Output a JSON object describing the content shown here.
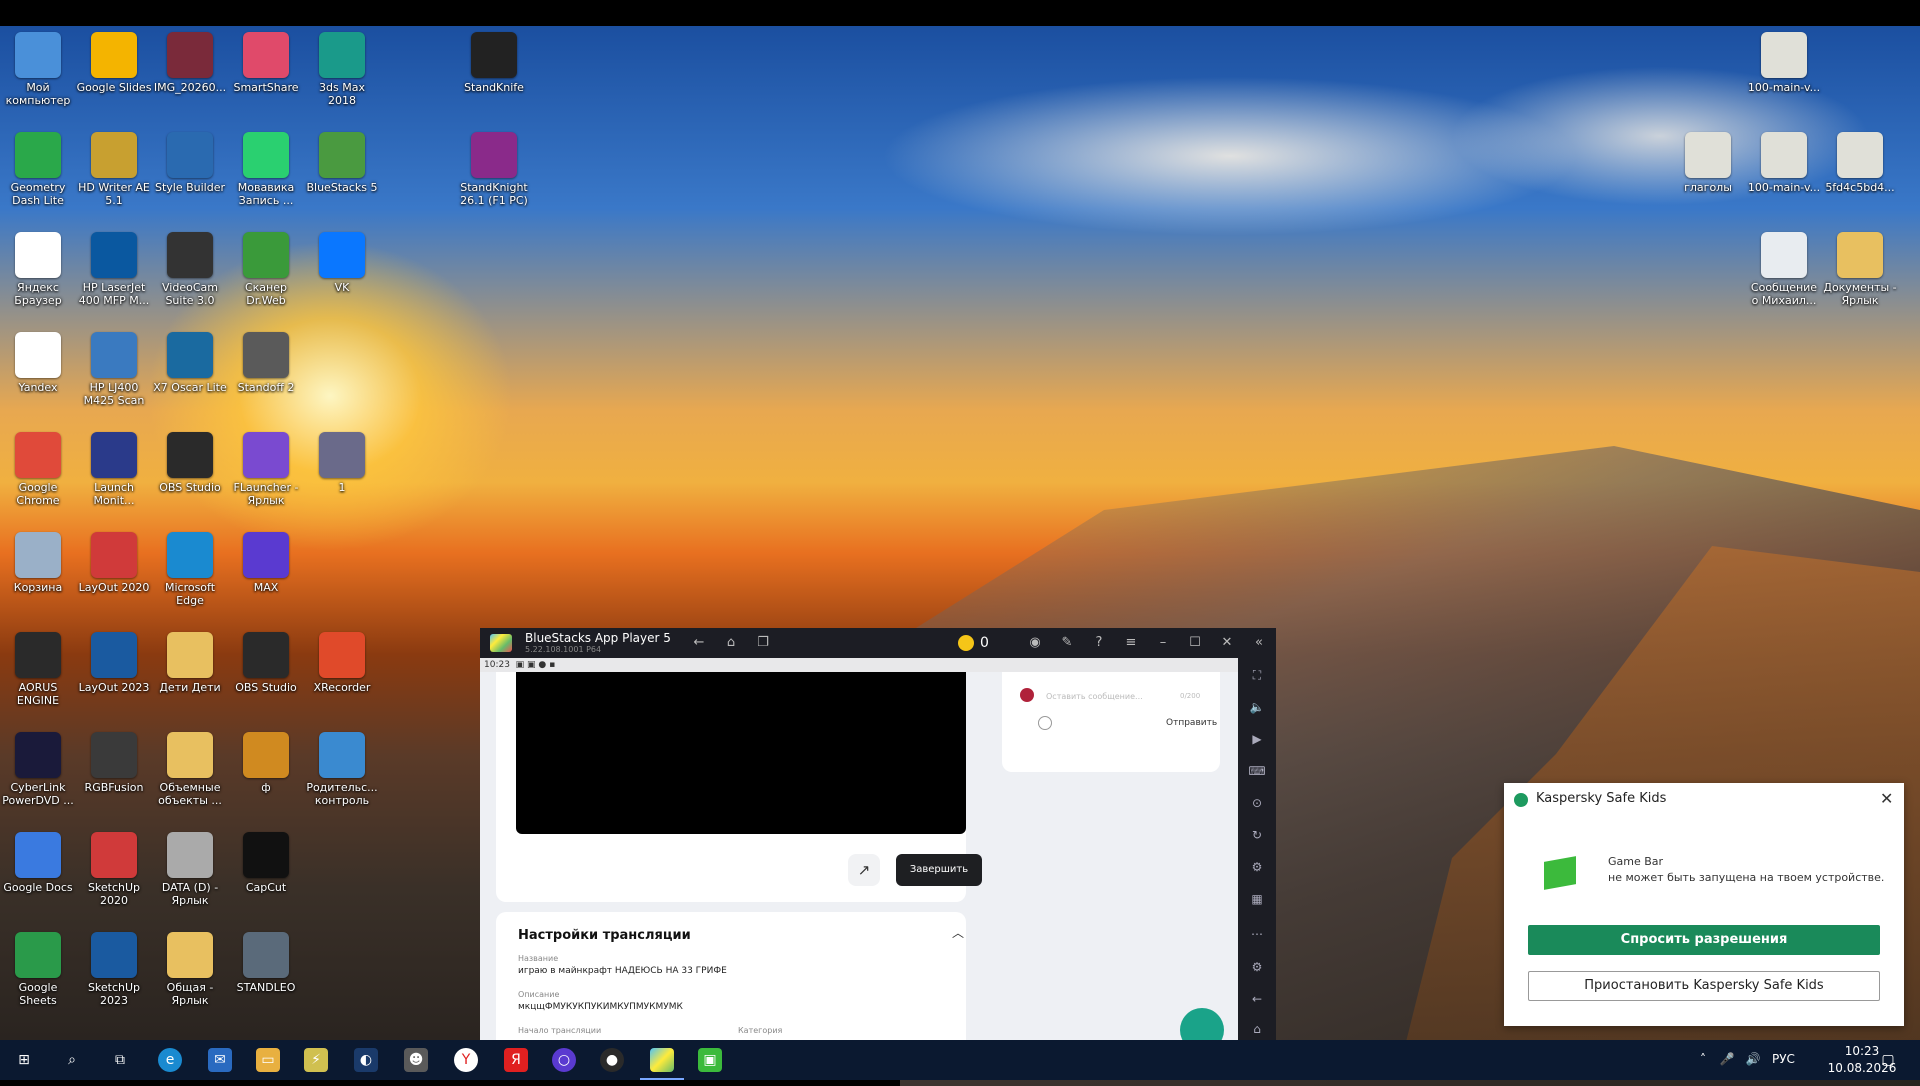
{
  "desktop": {
    "icons": [
      {
        "label": "Мой компьютер",
        "icon": "computer-icon",
        "color": "#4a90d9"
      },
      {
        "label": "Google Slides",
        "icon": "slides-icon",
        "color": "#f4b400"
      },
      {
        "label": "IMG_20260...",
        "icon": "image-icon",
        "color": "#7a2a3a"
      },
      {
        "label": "SmartShare",
        "icon": "smartshare-icon",
        "color": "#e04a6a"
      },
      {
        "label": "3ds Max 2018",
        "icon": "3dsmax-icon",
        "color": "#1a9a8a"
      },
      {
        "label": "StandKnife",
        "icon": "knife-icon",
        "color": "#222222"
      },
      {
        "label": "Geometry Dash Lite",
        "icon": "geometry-dash-icon",
        "color": "#2aa84a"
      },
      {
        "label": "HD Writer AE 5.1",
        "icon": "hd-writer-icon",
        "color": "#c8a030"
      },
      {
        "label": "Style Builder",
        "icon": "style-builder-icon",
        "color": "#2a6ab0"
      },
      {
        "label": "Мовавика Запись ...",
        "icon": "movavi-icon",
        "color": "#2ad070"
      },
      {
        "label": "BlueStacks 5",
        "icon": "bluestacks-icon",
        "color": "#4a9a40"
      },
      {
        "label": "StandKnight 26.1 (F1 PC)",
        "icon": "winrar-icon",
        "color": "#8a2a8a"
      },
      {
        "label": "Яндекс Браузер",
        "icon": "yandex-browser-icon",
        "color": "#ffffff"
      },
      {
        "label": "HP LaserJet 400 MFP M...",
        "icon": "hp-icon",
        "color": "#0a58a0"
      },
      {
        "label": "VideoCam Suite 3.0",
        "icon": "videocam-icon",
        "color": "#333333"
      },
      {
        "label": "Сканер Dr.Web",
        "icon": "drweb-icon",
        "color": "#3a9a3a"
      },
      {
        "label": "VK",
        "icon": "vk-icon",
        "color": "#0a77ff"
      },
      {
        "label": "Yandex",
        "icon": "yandex-icon",
        "color": "#ffffff"
      },
      {
        "label": "HP LJ400 M425 Scan",
        "icon": "hp-scan-icon",
        "color": "#3a7ac0"
      },
      {
        "label": "X7 Oscar Lite",
        "icon": "x7-icon",
        "color": "#1a6aa0"
      },
      {
        "label": "Standoff 2",
        "icon": "standoff-icon",
        "color": "#5a5a5a"
      },
      {
        "label": "Google Chrome",
        "icon": "chrome-icon",
        "color": "#e04a3a"
      },
      {
        "label": "Launch Monit...",
        "icon": "launch-monitor-icon",
        "color": "#2a3a8a"
      },
      {
        "label": "OBS Studio",
        "icon": "obs-icon",
        "color": "#2a2a2a"
      },
      {
        "label": "FLauncher - Ярлык",
        "icon": "flauncher-icon",
        "color": "#7a4ad0"
      },
      {
        "label": "1",
        "icon": "photo-icon",
        "color": "#6a6a8a"
      },
      {
        "label": "Корзина",
        "icon": "recycle-bin-icon",
        "color": "#9ab0c8"
      },
      {
        "label": "LayOut 2020",
        "icon": "layout-icon",
        "color": "#d03a3a"
      },
      {
        "label": "Microsoft Edge",
        "icon": "edge-icon",
        "color": "#1a8ad0"
      },
      {
        "label": "MAX",
        "icon": "max-icon",
        "color": "#5a3ad0"
      },
      {
        "label": "AORUS ENGINE",
        "icon": "aorus-icon",
        "color": "#2a2a2a"
      },
      {
        "label": "LayOut 2023",
        "icon": "layout-2023-icon",
        "color": "#1a5aa0"
      },
      {
        "label": "Дети Дети",
        "icon": "folder-icon",
        "color": "#e8c060"
      },
      {
        "label": "OBS Studio",
        "icon": "obs-icon",
        "color": "#2a2a2a"
      },
      {
        "label": "XRecorder",
        "icon": "xrecorder-icon",
        "color": "#e04a2a"
      },
      {
        "label": "CyberLink PowerDVD ...",
        "icon": "powerdvd-icon",
        "color": "#1a1a3a"
      },
      {
        "label": "RGBFusion",
        "icon": "rgbfusion-icon",
        "color": "#3a3a3a"
      },
      {
        "label": "Объемные объекты ...",
        "icon": "folder-3d-icon",
        "color": "#e8c060"
      },
      {
        "label": "ф",
        "icon": "csgo-icon",
        "color": "#d08a20"
      },
      {
        "label": "Родительс... контроль",
        "icon": "parental-control-icon",
        "color": "#3a8ad0"
      },
      {
        "label": "Google Docs",
        "icon": "docs-icon",
        "color": "#3a7ae0"
      },
      {
        "label": "SketchUp 2020",
        "icon": "sketchup-icon",
        "color": "#d03a3a"
      },
      {
        "label": "DATA (D) - Ярлык",
        "icon": "drive-icon",
        "color": "#aaaaaa"
      },
      {
        "label": "CapCut",
        "icon": "capcut-icon",
        "color": "#111111"
      },
      {
        "label": "Google Sheets",
        "icon": "sheets-icon",
        "color": "#2a9a4a"
      },
      {
        "label": "SketchUp 2023",
        "icon": "sketchup-2023-icon",
        "color": "#1a5aa0"
      },
      {
        "label": "Общая - Ярлык",
        "icon": "folder-icon",
        "color": "#e8c060"
      },
      {
        "label": "STANDLEO",
        "icon": "standleo-icon",
        "color": "#5a6a7a"
      },
      {
        "label": "100-main-v...",
        "icon": "file-icon",
        "color": "#e0e0d8"
      },
      {
        "label": "глаголы",
        "icon": "file-icon",
        "color": "#e0e0d8"
      },
      {
        "label": "100-main-v...",
        "icon": "file-icon",
        "color": "#e0e0d8"
      },
      {
        "label": "5fd4c5bd4...",
        "icon": "file-icon",
        "color": "#e0e0d8"
      },
      {
        "label": "Сообщение о Михаил...",
        "icon": "document-icon",
        "color": "#e8ecf0"
      },
      {
        "label": "Документы - Ярлык",
        "icon": "folder-docs-icon",
        "color": "#e8c060"
      }
    ]
  },
  "bluestacks": {
    "title": "BlueStacks App Player 5",
    "subtitle": "5.22.108.1001 P64",
    "coins": "0",
    "status_time": "10:23",
    "finish_label": "Завершить",
    "chat": {
      "placeholder": "Оставить сообщение...",
      "counter": "0/200",
      "send_label": "Отправить"
    },
    "settings": {
      "title": "Настройки трансляции",
      "name_label": "Название",
      "name_value": "играю в майнкрафт НАДЕЮСЬ НА 33 ГРИФЕ",
      "desc_label": "Описание",
      "desc_value": "мкцщФМУКУКПУКИМКУПМУКМУМК",
      "start_label": "Начало трансляции",
      "category_label": "Категория"
    }
  },
  "kaspersky": {
    "title": "Kaspersky Safe Kids",
    "app_name": "Game Bar",
    "message": "не может быть запущена на твоем устройстве.",
    "ask_button": "Спросить разрешения",
    "pause_button": "Приостановить Kaspersky Safe Kids"
  },
  "taskbar": {
    "language": "РУС",
    "time": "10:23",
    "date": "10.08.2026"
  }
}
